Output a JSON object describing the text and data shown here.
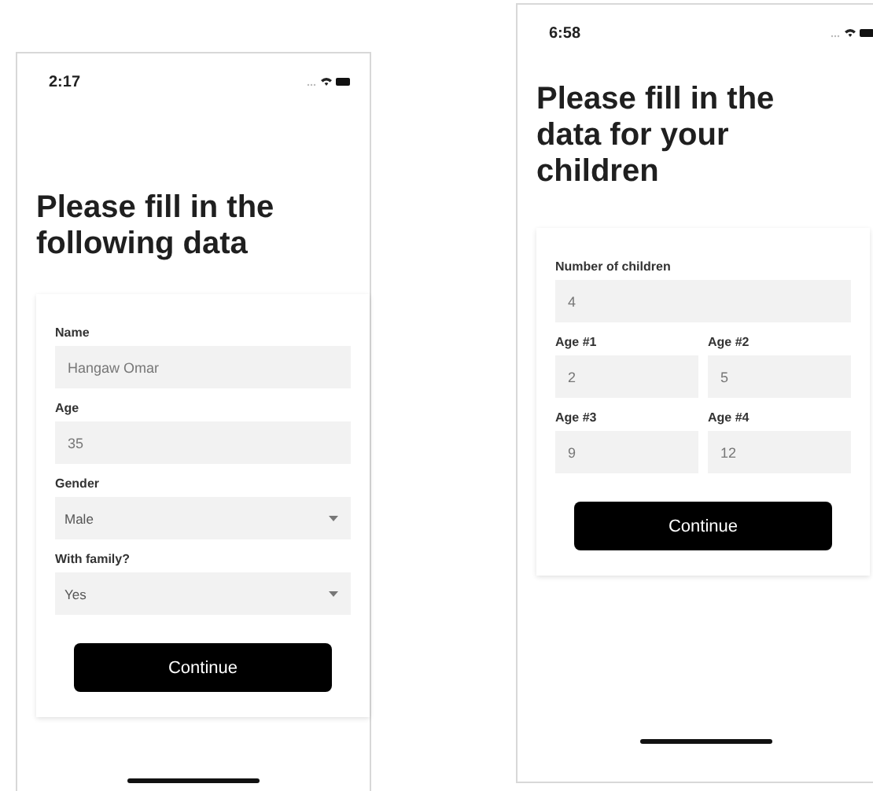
{
  "screens": [
    {
      "status_time": "2:17",
      "title": "Please fill in the following data",
      "form": [
        {
          "kind": "text",
          "label": "Name",
          "value": "Hangaw Omar"
        },
        {
          "kind": "text",
          "label": "Age",
          "value": "35"
        },
        {
          "kind": "select",
          "label": "Gender",
          "value": "Male"
        },
        {
          "kind": "select",
          "label": "With family?",
          "value": "Yes"
        }
      ],
      "button": "Continue"
    },
    {
      "status_time": "6:58",
      "title": "Please fill in the data for your children",
      "form": [
        {
          "kind": "text",
          "label": "Number of children",
          "value": "4"
        },
        {
          "kind": "pair",
          "fields": [
            {
              "label": "Age #1",
              "value": "2"
            },
            {
              "label": "Age #2",
              "value": "5"
            }
          ]
        },
        {
          "kind": "pair",
          "fields": [
            {
              "label": "Age #3",
              "value": "9"
            },
            {
              "label": "Age #4",
              "value": "12"
            }
          ]
        }
      ],
      "button": "Continue"
    }
  ]
}
